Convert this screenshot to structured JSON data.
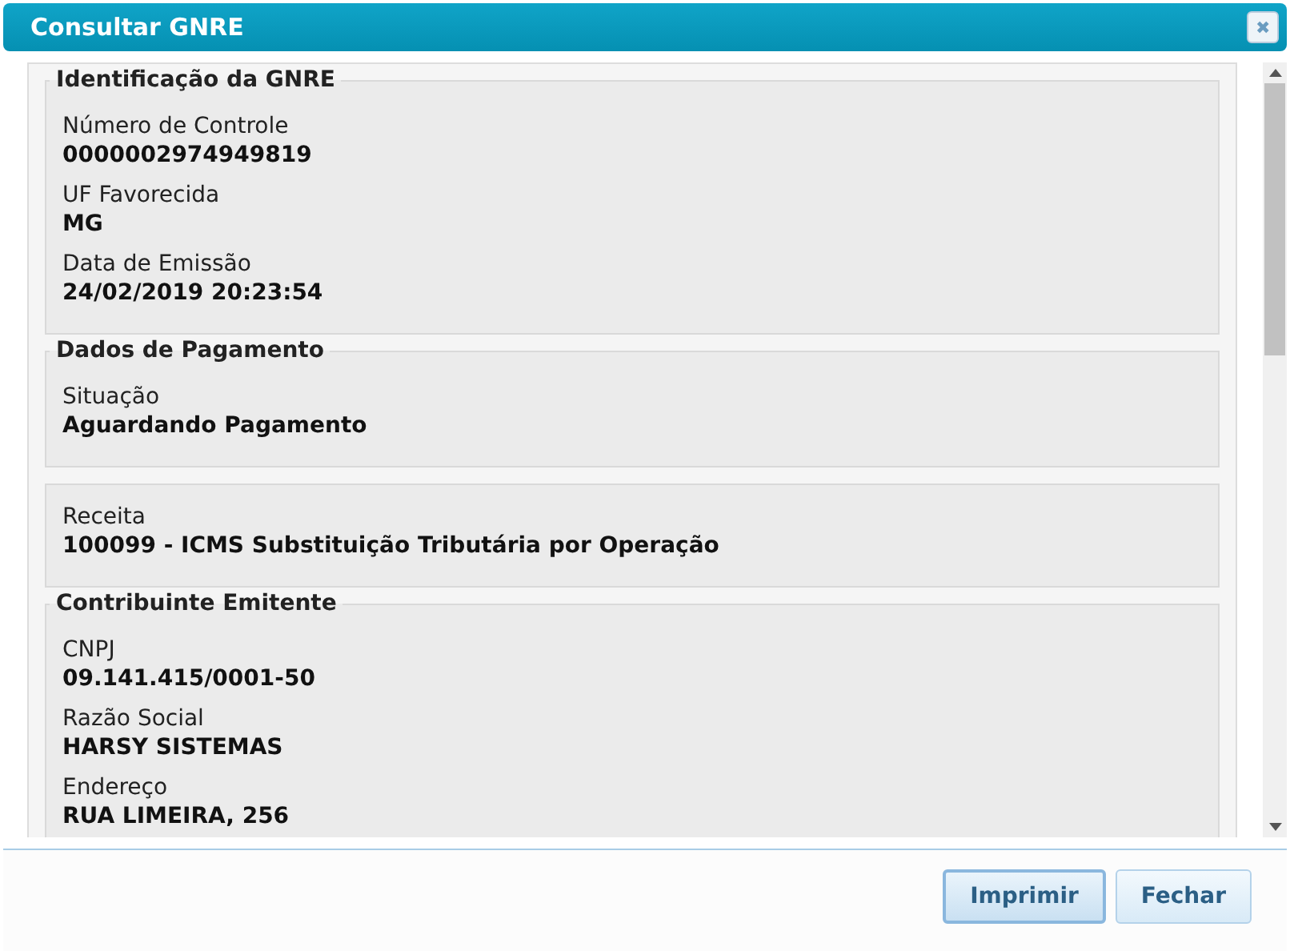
{
  "window": {
    "title": "Consultar GNRE",
    "close_icon": "✖"
  },
  "sections": [
    {
      "title": "Identificação da GNRE",
      "fields": [
        {
          "label": "Número de Controle",
          "value": "0000002974949819"
        },
        {
          "label": "UF Favorecida",
          "value": "MG"
        },
        {
          "label": "Data de Emissão",
          "value": "24/02/2019 20:23:54"
        }
      ]
    },
    {
      "title": "Dados de Pagamento",
      "fields": [
        {
          "label": "Situação",
          "value": "Aguardando Pagamento"
        }
      ]
    },
    {
      "fields": [
        {
          "label": "Receita",
          "value": "100099 - ICMS Substituição Tributária por Operação"
        }
      ]
    },
    {
      "title": "Contribuinte Emitente",
      "fields": [
        {
          "label": "CNPJ",
          "value": "09.141.415/0001-50"
        },
        {
          "label": "Razão Social",
          "value": "HARSY SISTEMAS"
        },
        {
          "label": "Endereço",
          "value": "RUA LIMEIRA, 256"
        }
      ]
    }
  ],
  "buttons": [
    {
      "label": "Imprimir",
      "selected": true
    },
    {
      "label": "Fechar",
      "selected": false
    }
  ]
}
